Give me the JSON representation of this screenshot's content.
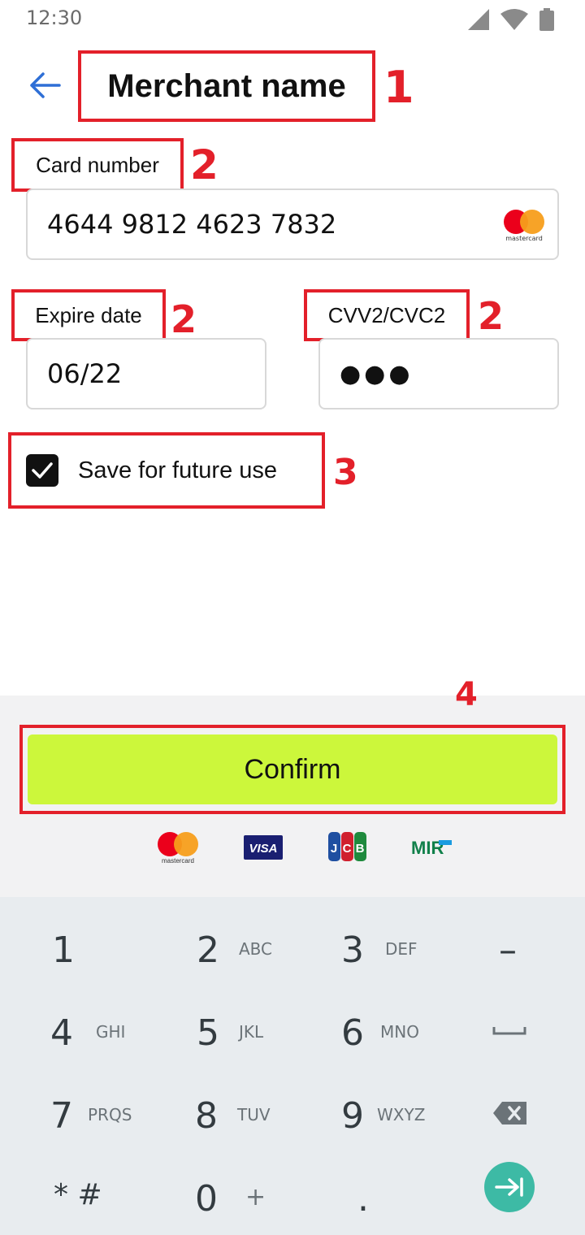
{
  "status_bar": {
    "time": "12:30",
    "icons": [
      "cellular-signal-icon",
      "wifi-icon",
      "battery-icon"
    ]
  },
  "header": {
    "title": "Merchant name",
    "back_icon": "arrow-left-icon"
  },
  "annotations": {
    "n1": "1",
    "n2a": "2",
    "n2b": "2",
    "n2c": "2",
    "n3": "3",
    "n4": "4"
  },
  "form": {
    "card_number": {
      "label": "Card number",
      "value": "4644 9812 4623 7832",
      "brand": "mastercard"
    },
    "expire": {
      "label": "Expire date",
      "value": "06/22"
    },
    "cvv": {
      "label": "CVV2/CVC2",
      "value": "●●●"
    },
    "save": {
      "label": "Save for future use",
      "checked": true
    }
  },
  "footer": {
    "confirm_label": "Confirm",
    "brands": [
      "mastercard",
      "VISA",
      "JCB",
      "MIR"
    ]
  },
  "keypad": {
    "r1": {
      "k1": "1",
      "k2": "2",
      "k2sub": "ABC",
      "k3": "3",
      "k3sub": "DEF",
      "k4": "–"
    },
    "r2": {
      "k1": "4",
      "k1sub": "GHI",
      "k2": "5",
      "k2sub": "JKL",
      "k3": "6",
      "k3sub": "MNO"
    },
    "r3": {
      "k1": "7",
      "k1sub": "PRQS",
      "k2": "8",
      "k2sub": "TUV",
      "k3": "9",
      "k3sub": "WXYZ"
    },
    "r4": {
      "k1": "* #",
      "k2": "0",
      "k2sub": "+",
      "k3": "."
    }
  },
  "colors": {
    "accent": "#ccf73b",
    "annotation": "#e3202a",
    "back_arrow": "#2f6fd6",
    "enter": "#3dbaa5"
  }
}
